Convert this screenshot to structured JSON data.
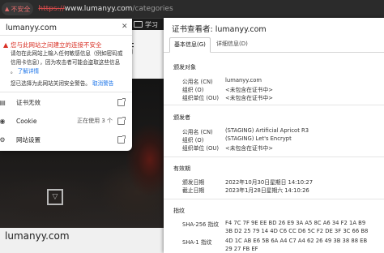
{
  "browser": {
    "security_chip": "不安全",
    "url_scheme": "https://",
    "url_host": "www.lumanyy.com",
    "url_path": "/categories",
    "bookmark_folder": "学习"
  },
  "background_page": {
    "footer_text": "lumanyy.com"
  },
  "site_info": {
    "domain": "lumanyy.com",
    "warning_title": "您与此网站之间建立的连接不安全",
    "warning_lines": [
      "请勿在此网站上输入任何敏感信息（例如密码或",
      "信用卡信息），因为攻击者可能会盗取这些信息",
      "。"
    ],
    "learn_more": "了解详情",
    "bypass_text": "您已选择为此网站关闭安全警告。",
    "revoke_link": "取消警告",
    "rows": [
      {
        "label": "证书无效",
        "value": ""
      },
      {
        "label": "Cookie",
        "value": "正在使用 3 个"
      },
      {
        "label": "网站设置",
        "value": ""
      }
    ]
  },
  "certificate": {
    "title": "证书查看者: lumanyy.com",
    "tabs": [
      "基本信息(G)",
      "详细信息(D)"
    ],
    "issued_to": {
      "heading": "颁发对象",
      "rows": [
        {
          "k": "公用名 (CN)",
          "v": "lumanyy.com"
        },
        {
          "k": "组织 (O)",
          "v": "<未包含在证书中>"
        },
        {
          "k": "组织单位 (OU)",
          "v": "<未包含在证书中>"
        }
      ]
    },
    "issued_by": {
      "heading": "颁发者",
      "rows": [
        {
          "k": "公用名 (CN)",
          "v": "(STAGING) Artificial Apricot R3"
        },
        {
          "k": "组织 (O)",
          "v": "(STAGING) Let's Encrypt"
        },
        {
          "k": "组织单位 (OU)",
          "v": "<未包含在证书中>"
        }
      ]
    },
    "validity": {
      "heading": "有效期",
      "rows": [
        {
          "k": "颁发日期",
          "v": "2022年10月30日星期日 14:10:27"
        },
        {
          "k": "截止日期",
          "v": "2023年1月28日星期六 14:10:26"
        }
      ]
    },
    "fingerprints": {
      "heading": "指纹",
      "rows": [
        {
          "k": "SHA-256 指纹",
          "v1": "F4 7C 7F 9E EE BD 26 E9 3A A5 8C A6 34 F2 1A B9",
          "v2": "3B D2 25 79 14 4D C6 CC D6 5C F2 DE 3F 3C 66 B8"
        },
        {
          "k": "SHA-1 指纹",
          "v1": "4D 1C AB E6 5B 6A A4 C7 A4 62 26 49 3B 38 88 EB",
          "v2": "29 27 FB EF"
        }
      ]
    }
  }
}
